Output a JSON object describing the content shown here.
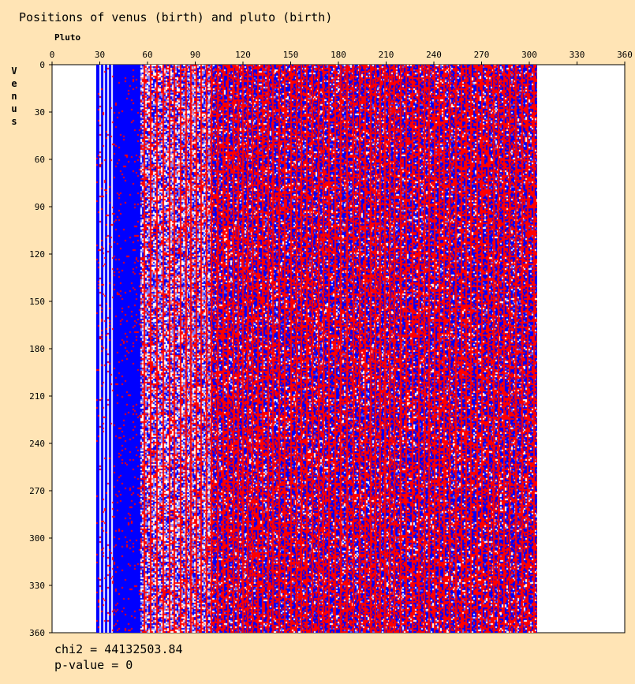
{
  "chart_data": {
    "type": "heatmap",
    "title": "Positions of venus (birth) and pluto (birth)",
    "xlabel": "Pluto",
    "ylabel": "Venus",
    "xlim": [
      0,
      360
    ],
    "ylim": [
      0,
      360
    ],
    "x_ticks": [
      "0",
      "30",
      "60",
      "90",
      "120",
      "150",
      "180",
      "210",
      "240",
      "270",
      "300",
      "330",
      "360"
    ],
    "y_ticks": [
      "0",
      "30",
      "60",
      "90",
      "120",
      "150",
      "180",
      "210",
      "240",
      "270",
      "300",
      "330",
      "360"
    ],
    "data_x_range": [
      28,
      305
    ],
    "grid": false,
    "colors": {
      "background": "#ffe4b5",
      "plot_background": "#ffffff",
      "low": "#0000ff",
      "high": "#ff0000",
      "neutral": "#ffffff"
    }
  },
  "stats": {
    "chi2": "chi2 = 44132503.84",
    "pvalue": "p-value = 0"
  }
}
